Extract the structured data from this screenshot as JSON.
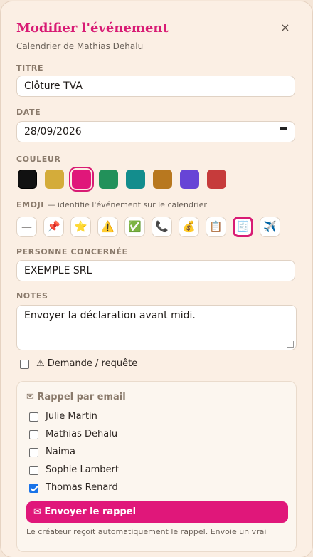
{
  "modal": {
    "title": "Modifier l'événement",
    "subtitle": "Calendrier de Mathias Dehalu",
    "close_glyph": "×"
  },
  "fields": {
    "title_label": "Titre",
    "title_value": "Clôture TVA",
    "date_label": "Date",
    "date_value": "28/09/2026",
    "color_label": "Couleur",
    "emoji_label": "Emoji",
    "emoji_hint": "— identifie l'événement sur le calendrier",
    "person_label": "Personne concernée",
    "person_value": "EXEMPLE SRL",
    "notes_label": "Notes",
    "notes_value": "Envoyer la déclaration avant midi."
  },
  "colors": [
    {
      "name": "black",
      "hex": "#111111",
      "selected": false
    },
    {
      "name": "gold",
      "hex": "#d4ac3a",
      "selected": false
    },
    {
      "name": "pink",
      "hex": "#e0177a",
      "selected": true
    },
    {
      "name": "green",
      "hex": "#22915a",
      "selected": false
    },
    {
      "name": "teal",
      "hex": "#138d8d",
      "selected": false
    },
    {
      "name": "ochre",
      "hex": "#b8781f",
      "selected": false
    },
    {
      "name": "violet",
      "hex": "#6744d6",
      "selected": false
    },
    {
      "name": "red",
      "hex": "#c63b3b",
      "selected": false
    }
  ],
  "emojis": [
    {
      "name": "none",
      "glyph": "—",
      "selected": false
    },
    {
      "name": "pin",
      "glyph": "📌",
      "selected": false
    },
    {
      "name": "star",
      "glyph": "⭐",
      "selected": false
    },
    {
      "name": "warning",
      "glyph": "⚠️",
      "selected": false
    },
    {
      "name": "check",
      "glyph": "✅",
      "selected": false
    },
    {
      "name": "phone",
      "glyph": "📞",
      "selected": false
    },
    {
      "name": "money-bag",
      "glyph": "💰",
      "selected": false
    },
    {
      "name": "clipboard",
      "glyph": "📋",
      "selected": false
    },
    {
      "name": "receipt",
      "glyph": "🧾",
      "selected": true
    },
    {
      "name": "airplane",
      "glyph": "✈️",
      "selected": false
    }
  ],
  "request": {
    "label": "⚠ Demande / requête",
    "checked": false
  },
  "reminder": {
    "title": "✉ Rappel par email",
    "people": [
      {
        "name": "Julie Martin",
        "checked": false
      },
      {
        "name": "Mathias Dehalu",
        "checked": false
      },
      {
        "name": "Naima",
        "checked": false
      },
      {
        "name": "Sophie Lambert",
        "checked": false
      },
      {
        "name": "Thomas Renard",
        "checked": true
      }
    ],
    "send_label": "✉ Envoyer le rappel",
    "note": "Le créateur reçoit automatiquement le rappel. Envoie un vrai"
  }
}
